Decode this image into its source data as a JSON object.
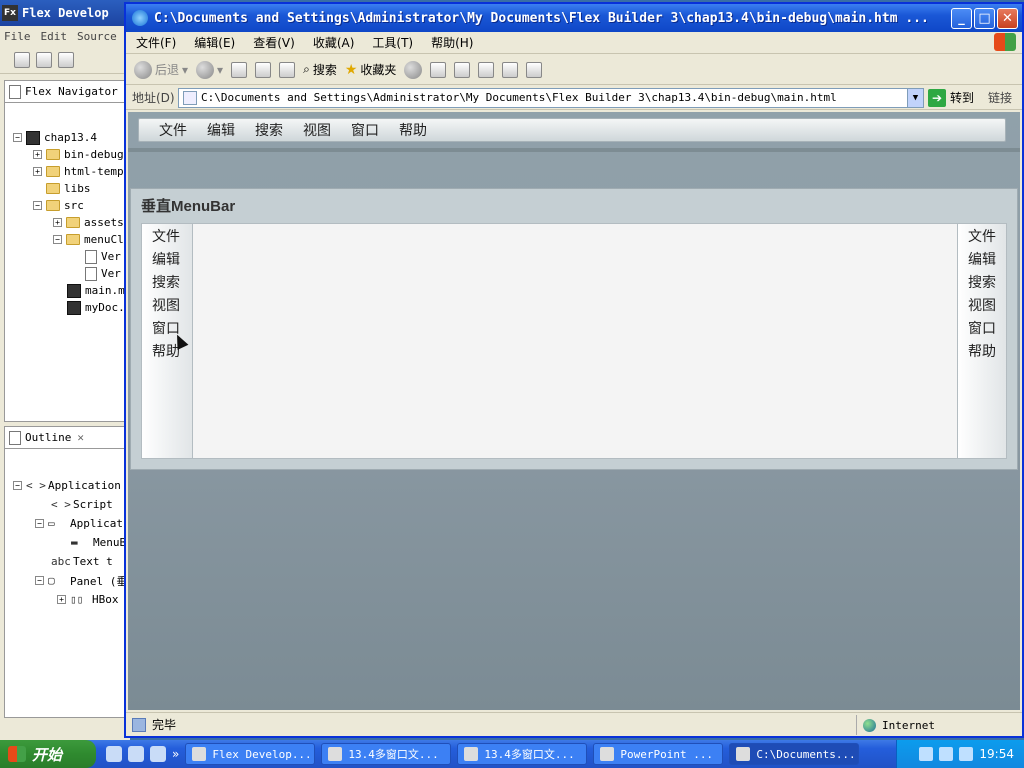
{
  "flex_window": {
    "title": "Flex Develop",
    "menu": [
      "File",
      "Edit",
      "Source"
    ],
    "navigator_title": "Flex Navigator",
    "tree": [
      {
        "label": "chap13.4",
        "type": "project",
        "toggle": "−"
      },
      {
        "label": "bin-debug",
        "type": "folder",
        "toggle": "+"
      },
      {
        "label": "html-temp",
        "type": "folder",
        "toggle": "+"
      },
      {
        "label": "libs",
        "type": "folder",
        "toggle": ""
      },
      {
        "label": "src",
        "type": "folder",
        "toggle": "−"
      },
      {
        "label": "assets",
        "type": "folder",
        "toggle": "+"
      },
      {
        "label": "menuCl",
        "type": "folder",
        "toggle": "−"
      },
      {
        "label": "Ver",
        "type": "file",
        "toggle": ""
      },
      {
        "label": "Ver",
        "type": "file",
        "toggle": ""
      },
      {
        "label": "main.m",
        "type": "mxml",
        "toggle": ""
      },
      {
        "label": "myDoc.",
        "type": "mxml",
        "toggle": ""
      }
    ],
    "outline_title": "Outline",
    "outline": [
      {
        "label": "Application",
        "icon": "< >",
        "toggle": "−"
      },
      {
        "label": "Script",
        "icon": "< >",
        "toggle": ""
      },
      {
        "label": "Applicat",
        "icon": "▭",
        "toggle": "−"
      },
      {
        "label": "MenuB",
        "icon": "▬",
        "toggle": ""
      },
      {
        "label": "Text t",
        "icon": "abc",
        "toggle": ""
      },
      {
        "label": "Panel (垂",
        "icon": "▢",
        "toggle": "−"
      },
      {
        "label": "HBox",
        "icon": "▯▯",
        "toggle": "+"
      }
    ]
  },
  "ie_window": {
    "title": "C:\\Documents and Settings\\Administrator\\My Documents\\Flex Builder 3\\chap13.4\\bin-debug\\main.htm ...",
    "menu": [
      "文件(F)",
      "编辑(E)",
      "查看(V)",
      "收藏(A)",
      "工具(T)",
      "帮助(H)"
    ],
    "toolbar": {
      "back": "后退",
      "search": "搜索",
      "favorites": "收藏夹"
    },
    "address_label": "地址(D)",
    "address": "C:\\Documents and Settings\\Administrator\\My Documents\\Flex Builder 3\\chap13.4\\bin-debug\\main.html",
    "go": "转到",
    "links": "链接",
    "status": "完毕",
    "zone": "Internet"
  },
  "flex_app": {
    "horizontal_menu": [
      "文件",
      "编辑",
      "搜索",
      "视图",
      "窗口",
      "帮助"
    ],
    "panel_title": "垂直MenuBar",
    "left_menu": [
      "文件",
      "编辑",
      "搜索",
      "视图",
      "窗口",
      "帮助"
    ],
    "right_menu": [
      "文件",
      "编辑",
      "搜索",
      "视图",
      "窗口",
      "帮助"
    ]
  },
  "taskbar": {
    "start": "开始",
    "tasks": [
      {
        "label": "Flex Develop...",
        "active": false
      },
      {
        "label": "13.4多窗口文...",
        "active": false
      },
      {
        "label": "13.4多窗口文...",
        "active": false
      },
      {
        "label": "PowerPoint ...",
        "active": false
      },
      {
        "label": "C:\\Documents...",
        "active": true
      }
    ],
    "clock": "19:54"
  }
}
